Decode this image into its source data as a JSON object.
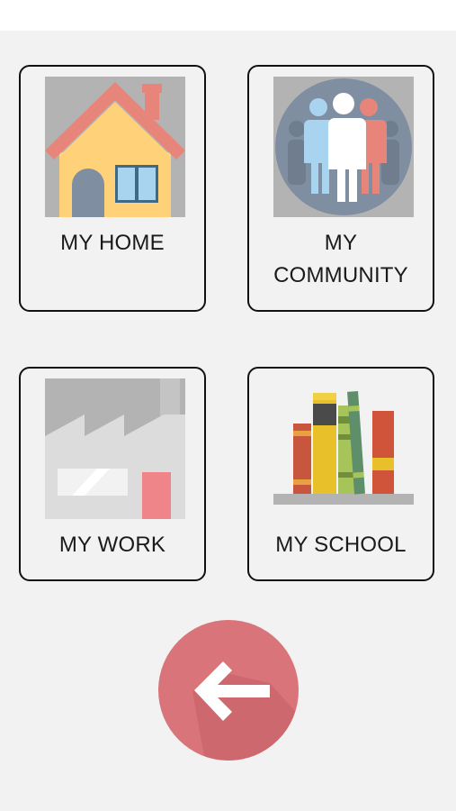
{
  "cards": {
    "home": {
      "label": "MY HOME",
      "icon": "house-icon"
    },
    "community": {
      "label_line1": "MY",
      "label_line2": "COMMUNITY",
      "icon": "people-icon"
    },
    "work": {
      "label": "MY WORK",
      "icon": "factory-icon"
    },
    "school": {
      "label": "MY SCHOOL",
      "icon": "books-icon"
    }
  },
  "back_button": {
    "icon": "arrow-left-icon",
    "color": "#d9747b"
  },
  "colors": {
    "background": "#f2f2f2",
    "card_border": "#111111",
    "label_text": "#1a1a1a"
  }
}
